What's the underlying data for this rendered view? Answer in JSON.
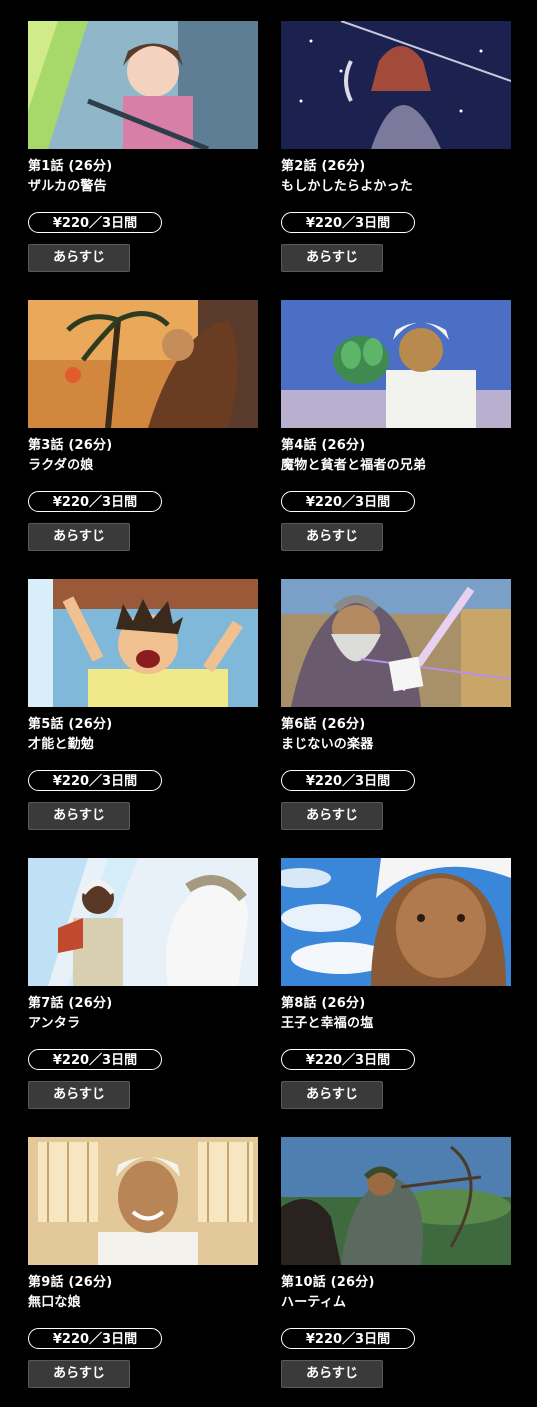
{
  "episodes": [
    {
      "num": "第1話 (26分)",
      "title": "ザルカの警告",
      "price": "¥220／3日間",
      "synopsis": "あらすじ",
      "scene": "girl-in-window"
    },
    {
      "num": "第2話 (26分)",
      "title": "もしかしたらよかった",
      "price": "¥220／3日間",
      "synopsis": "あらすじ",
      "scene": "night-man-dagger"
    },
    {
      "num": "第3話 (26分)",
      "title": "ラクダの娘",
      "price": "¥220／3日間",
      "synopsis": "あらすじ",
      "scene": "sunset-palm"
    },
    {
      "num": "第4話 (26分)",
      "title": "魔物と貧者と福者の兄弟",
      "price": "¥220／3日間",
      "synopsis": "あらすじ",
      "scene": "man-holding-plant"
    },
    {
      "num": "第5話 (26分)",
      "title": "才能と勤勉",
      "price": "¥220／3日間",
      "synopsis": "あらすじ",
      "scene": "shouting-boy"
    },
    {
      "num": "第6話 (26分)",
      "title": "まじないの楽器",
      "price": "¥220／3日間",
      "synopsis": "あらすじ",
      "scene": "old-man-instrument"
    },
    {
      "num": "第7話 (26分)",
      "title": "アンタラ",
      "price": "¥220／3日間",
      "synopsis": "あらすじ",
      "scene": "warrior-white-horse"
    },
    {
      "num": "第8話 (26分)",
      "title": "王子と幸福の塩",
      "price": "¥220／3日間",
      "synopsis": "あらすじ",
      "scene": "young-man-sky"
    },
    {
      "num": "第9話 (26分)",
      "title": "無口な娘",
      "price": "¥220／3日間",
      "synopsis": "あらすじ",
      "scene": "smiling-man-window"
    },
    {
      "num": "第10話 (26分)",
      "title": "ハーティム",
      "price": "¥220／3日間",
      "synopsis": "あらすじ",
      "scene": "archer-on-horse"
    }
  ],
  "colors": {
    "background": "#000000",
    "text": "#ffffff",
    "button_bg": "#3a3a3a",
    "button_border": "#5a5a5a"
  }
}
